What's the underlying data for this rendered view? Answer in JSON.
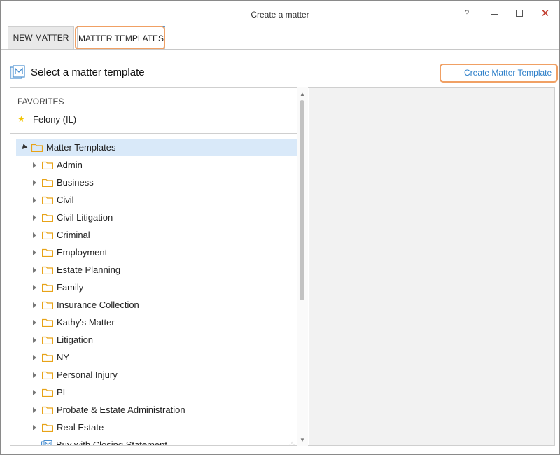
{
  "window": {
    "title": "Create a matter",
    "controls": {
      "help": "?",
      "close": "✕"
    }
  },
  "tabs": [
    {
      "label": "NEW MATTER",
      "active": false
    },
    {
      "label": "MATTER TEMPLATES",
      "active": true
    }
  ],
  "header": {
    "heading": "Select a matter template",
    "icon": "matter-template-icon",
    "create_link": "Create Matter Template"
  },
  "favorites": {
    "label": "FAVORITES",
    "items": [
      {
        "label": "Felony (IL)",
        "icon": "star-icon"
      }
    ]
  },
  "tree": {
    "root": {
      "label": "Matter Templates",
      "expanded": true,
      "selected": true
    },
    "children": [
      {
        "label": "Admin"
      },
      {
        "label": "Business"
      },
      {
        "label": "Civil"
      },
      {
        "label": "Civil Litigation"
      },
      {
        "label": "Criminal"
      },
      {
        "label": "Employment"
      },
      {
        "label": "Estate Planning"
      },
      {
        "label": "Family"
      },
      {
        "label": "Insurance Collection"
      },
      {
        "label": "Kathy's Matter"
      },
      {
        "label": "Litigation"
      },
      {
        "label": "NY"
      },
      {
        "label": "Personal Injury"
      },
      {
        "label": "PI"
      },
      {
        "label": "Probate & Estate Administration"
      },
      {
        "label": "Real Estate"
      }
    ],
    "documents": [
      {
        "label": "Buy with Closing Statement",
        "icon": "template-document-icon"
      }
    ]
  },
  "colors": {
    "accent_blue": "#2d7fc9",
    "highlight_orange": "#f0a064",
    "folder_yellow": "#e8a317",
    "selection_bg": "#d9e9f9",
    "star_yellow": "#f2c400"
  }
}
